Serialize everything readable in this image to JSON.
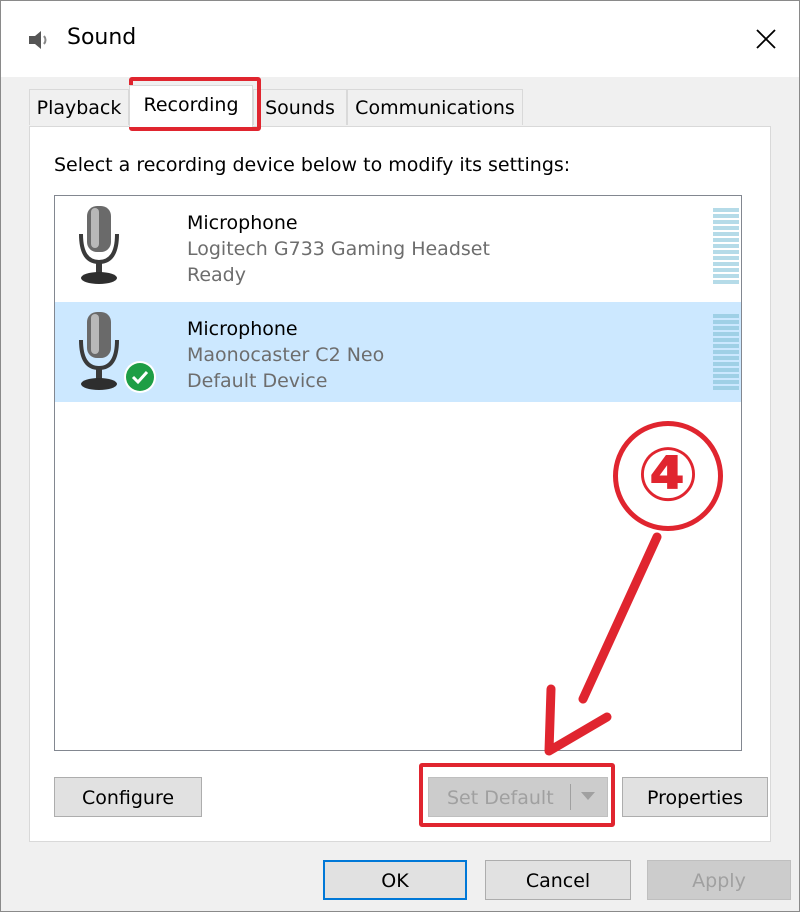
{
  "window": {
    "title": "Sound",
    "close_symbol": "✕",
    "icons": {
      "title": "speaker-icon",
      "close": "close-icon"
    }
  },
  "tabs": [
    {
      "label": "Playback",
      "active": false
    },
    {
      "label": "Recording",
      "active": true
    },
    {
      "label": "Sounds",
      "active": false
    },
    {
      "label": "Communications",
      "active": false
    }
  ],
  "panel": {
    "instruction": "Select a recording device below to modify its settings:"
  },
  "devices": [
    {
      "name": "Microphone",
      "description": "Logitech G733 Gaming Headset",
      "status": "Ready",
      "selected": false,
      "is_default": false,
      "icon": "microphone-icon"
    },
    {
      "name": "Microphone",
      "description": "Maonocaster C2 Neo",
      "status": "Default Device",
      "selected": true,
      "is_default": true,
      "icon": "microphone-icon",
      "badge_icon": "default-check-icon"
    }
  ],
  "buttons": {
    "configure": "Configure",
    "set_default": "Set Default",
    "properties": "Properties",
    "ok": "OK",
    "cancel": "Cancel",
    "apply": "Apply"
  },
  "annotation": {
    "step": "④",
    "color": "#e0252f"
  },
  "colors": {
    "selection": "#cce8ff",
    "focus_border": "#0078d7",
    "meter_idle": "#b5dbe8",
    "meter_selected": "#9fd0e6",
    "default_badge": "#1e9e45"
  }
}
